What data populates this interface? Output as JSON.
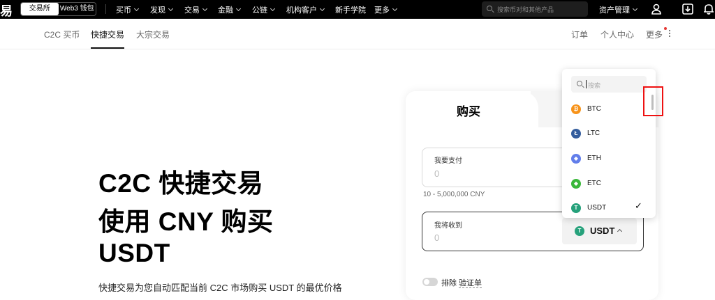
{
  "topbar": {
    "logo_char": "易",
    "segment": [
      "交易所",
      "Web3 钱包"
    ],
    "nav": [
      {
        "label": "买币",
        "dropdown": true
      },
      {
        "label": "发现",
        "dropdown": true
      },
      {
        "label": "交易",
        "dropdown": true
      },
      {
        "label": "金融",
        "dropdown": true
      },
      {
        "label": "公链",
        "dropdown": true
      },
      {
        "label": "机构客户",
        "dropdown": true
      },
      {
        "label": "新手学院",
        "dropdown": false
      },
      {
        "label": "更多",
        "dropdown": true
      }
    ],
    "search_placeholder": "搜索币对和其他产品",
    "asset_label": "资产管理"
  },
  "subnav": {
    "left": [
      "C2C 买币",
      "快捷交易",
      "大宗交易"
    ],
    "active_index": 1,
    "right": [
      "订单",
      "个人中心",
      "更多"
    ]
  },
  "hero": {
    "line1": "C2C 快捷交易",
    "line2": "使用 CNY 购买",
    "line3": "USDT",
    "desc": "快捷交易为您自动匹配当前 C2C 市场购买 USDT 的最优价格"
  },
  "card": {
    "tab_buy": "购买",
    "pay_label": "我要支付",
    "pay_value": "0",
    "range": "10 - 5,000,000 CNY",
    "receive_label": "我将收到",
    "receive_value": "0",
    "selected_coin": "USDT",
    "toggle_label_prefix": "排除 ",
    "toggle_label_link": "验证单"
  },
  "dropdown": {
    "search_placeholder": "搜索",
    "coins": [
      {
        "name": "BTC",
        "color": "#f7931a",
        "glyph": "₿",
        "selected": false
      },
      {
        "name": "LTC",
        "color": "#345d9d",
        "glyph": "Ł",
        "selected": false
      },
      {
        "name": "ETH",
        "color": "#627eea",
        "glyph": "◆",
        "selected": false
      },
      {
        "name": "ETC",
        "color": "#3ab83a",
        "glyph": "◆",
        "selected": false
      },
      {
        "name": "USDT",
        "color": "#26a17b",
        "glyph": "T",
        "selected": true
      }
    ],
    "check_glyph": "✓"
  },
  "colors": {
    "usdt": "#26a17b",
    "highlight": "#e11111"
  }
}
